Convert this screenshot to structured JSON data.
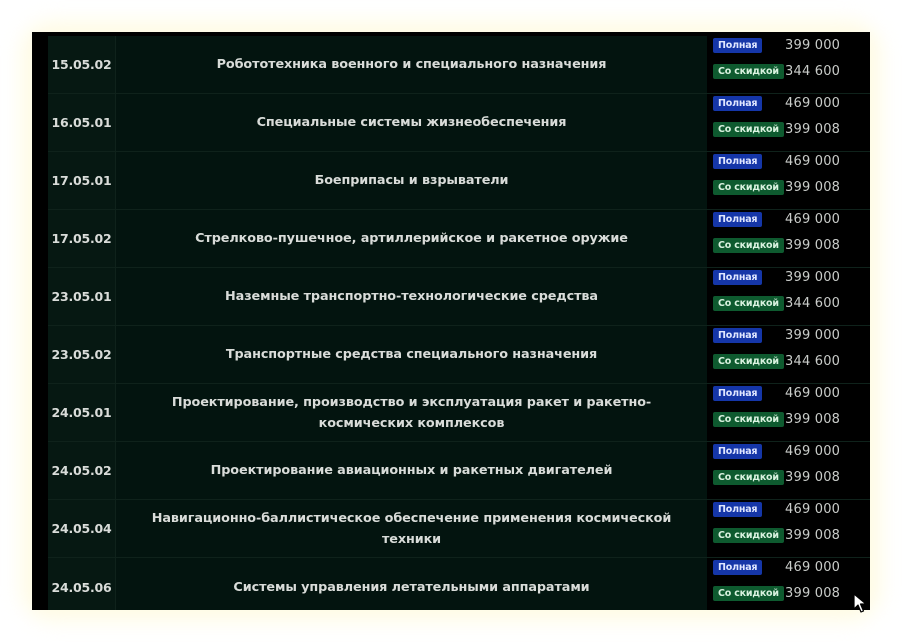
{
  "labels": {
    "full": "Полная",
    "discount": "Со скидкой"
  },
  "rows": [
    {
      "code": "15.05.02",
      "name": "Робототехника военного и специального назначения",
      "full": "399 000",
      "discount": "344 600"
    },
    {
      "code": "16.05.01",
      "name": "Специальные системы жизнеобеспечения",
      "full": "469 000",
      "discount": "399 008"
    },
    {
      "code": "17.05.01",
      "name": "Боеприпасы и взрыватели",
      "full": "469 000",
      "discount": "399 008"
    },
    {
      "code": "17.05.02",
      "name": "Стрелково-пушечное, артиллерийское и ракетное оружие",
      "full": "469 000",
      "discount": "399 008"
    },
    {
      "code": "23.05.01",
      "name": "Наземные транспортно-технологические средства",
      "full": "399 000",
      "discount": "344 600"
    },
    {
      "code": "23.05.02",
      "name": "Транспортные средства специального назначения",
      "full": "399 000",
      "discount": "344 600"
    },
    {
      "code": "24.05.01",
      "name": "Проектирование, производство и эксплуатация ракет и ракетно-космических комплексов",
      "full": "469 000",
      "discount": "399 008"
    },
    {
      "code": "24.05.02",
      "name": "Проектирование авиационных и ракетных двигателей",
      "full": "469 000",
      "discount": "399 008"
    },
    {
      "code": "24.05.04",
      "name": "Навигационно-баллистическое обеспечение применения космической техники",
      "full": "469 000",
      "discount": "399 008"
    },
    {
      "code": "24.05.06",
      "name": "Системы управления летательными аппаратами",
      "full": "469 000",
      "discount": "399 008"
    }
  ],
  "colors": {
    "badge_full": "#1536a8",
    "badge_discount": "#0e5a2f",
    "row_bg": "#03140f",
    "page_bg": "#000000"
  },
  "icons": {
    "cursor": "mouse-pointer-icon"
  }
}
